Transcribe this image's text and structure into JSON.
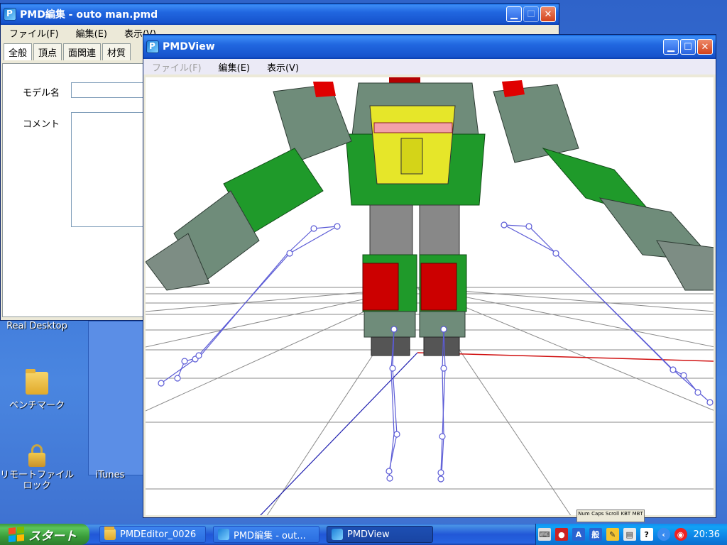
{
  "desktop": {
    "icons": [
      {
        "label": "Real Desktop"
      },
      {
        "label": "ベンチマーク"
      },
      {
        "label": "リモートファイルロック"
      }
    ],
    "partial_label": "iTunes"
  },
  "editor_window": {
    "title": "PMD編集 - outo man.pmd",
    "menu": [
      "ファイル(F)",
      "編集(E)",
      "表示(V)"
    ],
    "tabs": [
      "全般",
      "頂点",
      "面関連",
      "材質"
    ],
    "fields": {
      "model_name_label": "モデル名",
      "model_name_value": "",
      "comment_label": "コメント",
      "comment_value": ""
    }
  },
  "view_window": {
    "title": "PMDView",
    "menu": [
      {
        "label": "ファイル(F)",
        "enabled": false
      },
      {
        "label": "編集(E)",
        "enabled": true
      },
      {
        "label": "表示(V)",
        "enabled": true
      }
    ]
  },
  "taskbar": {
    "start_label": "スタート",
    "tasks": [
      {
        "label": "PMDEditor_0026",
        "active": false
      },
      {
        "label": "PMD編集 - out...",
        "active": false
      },
      {
        "label": "PMDView",
        "active": true
      }
    ],
    "keyboard_indicators": [
      "Num",
      "Caps",
      "Scroll",
      "KBT",
      "MBT"
    ],
    "ime_mode": "A",
    "ime_label": "般",
    "clock": "20:36"
  },
  "colors": {
    "robot_green": "#1f9a2a",
    "robot_gray": "#6f8c7a",
    "robot_red": "#cc0000",
    "robot_yellow": "#e6e629",
    "bone_blue": "#5b5bd6",
    "grid_gray": "#8a8a8a",
    "axis_red": "#d01010",
    "axis_blue": "#2020b0"
  }
}
